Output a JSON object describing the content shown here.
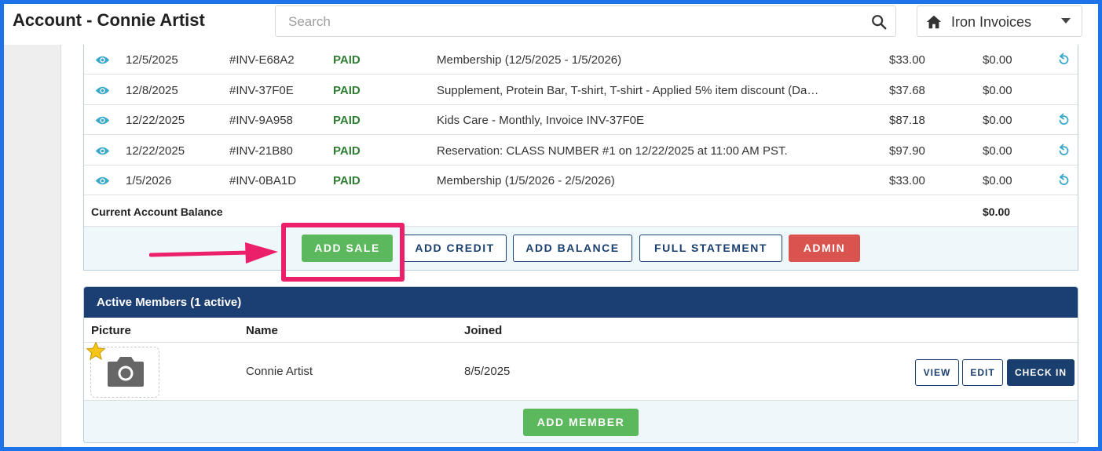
{
  "header": {
    "title": "Account - Connie Artist",
    "search_placeholder": "Search",
    "location": "Iron Invoices"
  },
  "invoices": [
    {
      "date": "12/5/2025",
      "number": "#INV-E68A2",
      "status": "PAID",
      "description": "Membership (12/5/2025 - 1/5/2026)",
      "amount": "$33.00",
      "balance": "$0.00",
      "refundable": true
    },
    {
      "date": "12/8/2025",
      "number": "#INV-37F0E",
      "status": "PAID",
      "description": "Supplement, Protein Bar, T-shirt, T-shirt - Applied 5% item discount (Da…",
      "amount": "$37.68",
      "balance": "$0.00",
      "refundable": false
    },
    {
      "date": "12/22/2025",
      "number": "#INV-9A958",
      "status": "PAID",
      "description": "Kids Care - Monthly, Invoice INV-37F0E",
      "amount": "$87.18",
      "balance": "$0.00",
      "refundable": true
    },
    {
      "date": "12/22/2025",
      "number": "#INV-21B80",
      "status": "PAID",
      "description": "Reservation: CLASS NUMBER #1 on 12/22/2025 at 11:00 AM PST.",
      "amount": "$97.90",
      "balance": "$0.00",
      "refundable": true
    },
    {
      "date": "1/5/2026",
      "number": "#INV-0BA1D",
      "status": "PAID",
      "description": "Membership (1/5/2026 - 2/5/2026)",
      "amount": "$33.00",
      "balance": "$0.00",
      "refundable": true
    }
  ],
  "balance": {
    "label": "Current Account Balance",
    "value": "$0.00"
  },
  "actions": {
    "add_sale": "ADD SALE",
    "add_credit": "ADD CREDIT",
    "add_balance": "ADD BALANCE",
    "full_statement": "FULL STATEMENT",
    "admin": "ADMIN"
  },
  "members": {
    "title": "Active Members (1 active)",
    "columns": {
      "picture": "Picture",
      "name": "Name",
      "joined": "Joined"
    },
    "rows": [
      {
        "name": "Connie Artist",
        "joined": "8/5/2025",
        "primary": true
      }
    ],
    "buttons": {
      "view": "VIEW",
      "edit": "EDIT",
      "check_in": "CHECK IN"
    },
    "add_member": "ADD MEMBER"
  },
  "colors": {
    "brand_navy": "#1b3f72",
    "paid_green": "#2e7d32",
    "action_green": "#5cb85c",
    "danger_red": "#d9534f",
    "annotation_pink": "#ec1f6a",
    "link_teal": "#3aa9c9"
  },
  "icons": [
    "search-icon",
    "home-icon",
    "chevron-down-icon",
    "eye-icon",
    "refund-icon",
    "camera-icon",
    "star-icon",
    "arrow-icon"
  ]
}
